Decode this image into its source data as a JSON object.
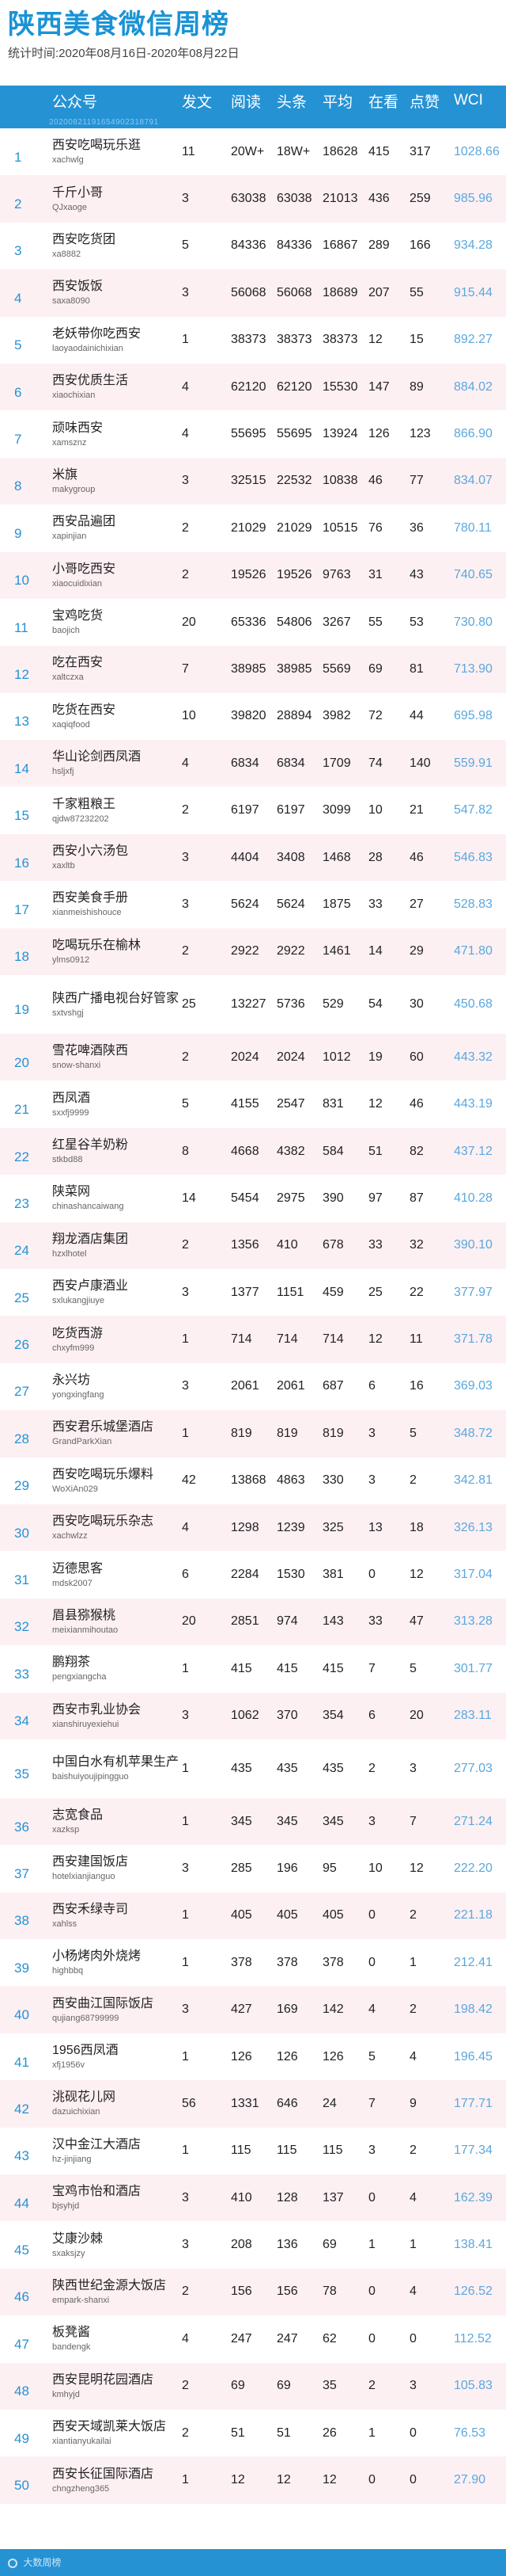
{
  "title": "陕西美食微信周榜",
  "period": "统计时间:2020年08月16日-2020年08月22日",
  "columns": {
    "account": "公众号",
    "posts": "发文",
    "reads": "阅读",
    "headline": "头条",
    "average": "平均",
    "looking": "在看",
    "likes": "点赞",
    "wci": "WCI"
  },
  "header_watermark": "20200821191654902318791",
  "rows": [
    {
      "rank": "1",
      "name": "西安吃喝玩乐逛",
      "id": "xachwlg",
      "posts": "11",
      "reads": "20W+",
      "headline": "18W+",
      "average": "18628",
      "looking": "415",
      "likes": "317",
      "wci": "1028.66"
    },
    {
      "rank": "2",
      "name": "千斤小哥",
      "id": "QJxaoge",
      "posts": "3",
      "reads": "63038",
      "headline": "63038",
      "average": "21013",
      "looking": "436",
      "likes": "259",
      "wci": "985.96"
    },
    {
      "rank": "3",
      "name": "西安吃货团",
      "id": "xa8882",
      "posts": "5",
      "reads": "84336",
      "headline": "84336",
      "average": "16867",
      "looking": "289",
      "likes": "166",
      "wci": "934.28"
    },
    {
      "rank": "4",
      "name": "西安饭饭",
      "id": "saxa8090",
      "posts": "3",
      "reads": "56068",
      "headline": "56068",
      "average": "18689",
      "looking": "207",
      "likes": "55",
      "wci": "915.44"
    },
    {
      "rank": "5",
      "name": "老妖带你吃西安",
      "id": "laoyaodainichixian",
      "posts": "1",
      "reads": "38373",
      "headline": "38373",
      "average": "38373",
      "looking": "12",
      "likes": "15",
      "wci": "892.27"
    },
    {
      "rank": "6",
      "name": "西安优质生活",
      "id": "xiaochixian",
      "posts": "4",
      "reads": "62120",
      "headline": "62120",
      "average": "15530",
      "looking": "147",
      "likes": "89",
      "wci": "884.02"
    },
    {
      "rank": "7",
      "name": "顽味西安",
      "id": "xamsznz",
      "posts": "4",
      "reads": "55695",
      "headline": "55695",
      "average": "13924",
      "looking": "126",
      "likes": "123",
      "wci": "866.90"
    },
    {
      "rank": "8",
      "name": "米旗",
      "id": "makygroup",
      "posts": "3",
      "reads": "32515",
      "headline": "22532",
      "average": "10838",
      "looking": "46",
      "likes": "77",
      "wci": "834.07"
    },
    {
      "rank": "9",
      "name": "西安品遍团",
      "id": "xapinjian",
      "posts": "2",
      "reads": "21029",
      "headline": "21029",
      "average": "10515",
      "looking": "76",
      "likes": "36",
      "wci": "780.11"
    },
    {
      "rank": "10",
      "name": "小哥吃西安",
      "id": "xiaocuidixian",
      "posts": "2",
      "reads": "19526",
      "headline": "19526",
      "average": "9763",
      "looking": "31",
      "likes": "43",
      "wci": "740.65"
    },
    {
      "rank": "11",
      "name": "宝鸡吃货",
      "id": "baojich",
      "posts": "20",
      "reads": "65336",
      "headline": "54806",
      "average": "3267",
      "looking": "55",
      "likes": "53",
      "wci": "730.80"
    },
    {
      "rank": "12",
      "name": "吃在西安",
      "id": "xaltczxa",
      "posts": "7",
      "reads": "38985",
      "headline": "38985",
      "average": "5569",
      "looking": "69",
      "likes": "81",
      "wci": "713.90"
    },
    {
      "rank": "13",
      "name": "吃货在西安",
      "id": "xaqiqfood",
      "posts": "10",
      "reads": "39820",
      "headline": "28894",
      "average": "3982",
      "looking": "72",
      "likes": "44",
      "wci": "695.98"
    },
    {
      "rank": "14",
      "name": "华山论剑西凤酒",
      "id": "hsljxfj",
      "posts": "4",
      "reads": "6834",
      "headline": "6834",
      "average": "1709",
      "looking": "74",
      "likes": "140",
      "wci": "559.91"
    },
    {
      "rank": "15",
      "name": "千家粗粮王",
      "id": "qjdw87232202",
      "posts": "2",
      "reads": "6197",
      "headline": "6197",
      "average": "3099",
      "looking": "10",
      "likes": "21",
      "wci": "547.82"
    },
    {
      "rank": "16",
      "name": "西安小六汤包",
      "id": "xaxltb",
      "posts": "3",
      "reads": "4404",
      "headline": "3408",
      "average": "1468",
      "looking": "28",
      "likes": "46",
      "wci": "546.83"
    },
    {
      "rank": "17",
      "name": "西安美食手册",
      "id": "xianmeishishouce",
      "posts": "3",
      "reads": "5624",
      "headline": "5624",
      "average": "1875",
      "looking": "33",
      "likes": "27",
      "wci": "528.83"
    },
    {
      "rank": "18",
      "name": "吃喝玩乐在榆林",
      "id": "ylms0912",
      "posts": "2",
      "reads": "2922",
      "headline": "2922",
      "average": "1461",
      "looking": "14",
      "likes": "29",
      "wci": "471.80"
    },
    {
      "rank": "19",
      "name": "陕西广播电视台好管家",
      "id": "sxtvshgj",
      "posts": "25",
      "reads": "13227",
      "headline": "5736",
      "average": "529",
      "looking": "54",
      "likes": "30",
      "wci": "450.68",
      "tall": true
    },
    {
      "rank": "20",
      "name": "雪花啤酒陕西",
      "id": "snow-shanxi",
      "posts": "2",
      "reads": "2024",
      "headline": "2024",
      "average": "1012",
      "looking": "19",
      "likes": "60",
      "wci": "443.32"
    },
    {
      "rank": "21",
      "name": "西凤酒",
      "id": "sxxfj9999",
      "posts": "5",
      "reads": "4155",
      "headline": "2547",
      "average": "831",
      "looking": "12",
      "likes": "46",
      "wci": "443.19"
    },
    {
      "rank": "22",
      "name": "红星谷羊奶粉",
      "id": "stkbd88",
      "posts": "8",
      "reads": "4668",
      "headline": "4382",
      "average": "584",
      "looking": "51",
      "likes": "82",
      "wci": "437.12"
    },
    {
      "rank": "23",
      "name": "陕菜网",
      "id": "chinashancaiwang",
      "posts": "14",
      "reads": "5454",
      "headline": "2975",
      "average": "390",
      "looking": "97",
      "likes": "87",
      "wci": "410.28"
    },
    {
      "rank": "24",
      "name": "翔龙酒店集团",
      "id": "hzxlhotel",
      "posts": "2",
      "reads": "1356",
      "headline": "410",
      "average": "678",
      "looking": "33",
      "likes": "32",
      "wci": "390.10"
    },
    {
      "rank": "25",
      "name": "西安卢康酒业",
      "id": "sxlukangjiuye",
      "posts": "3",
      "reads": "1377",
      "headline": "1151",
      "average": "459",
      "looking": "25",
      "likes": "22",
      "wci": "377.97"
    },
    {
      "rank": "26",
      "name": "吃货西游",
      "id": "chxyfm999",
      "posts": "1",
      "reads": "714",
      "headline": "714",
      "average": "714",
      "looking": "12",
      "likes": "11",
      "wci": "371.78"
    },
    {
      "rank": "27",
      "name": "永兴坊",
      "id": "yongxingfang",
      "posts": "3",
      "reads": "2061",
      "headline": "2061",
      "average": "687",
      "looking": "6",
      "likes": "16",
      "wci": "369.03"
    },
    {
      "rank": "28",
      "name": "西安君乐城堡酒店",
      "id": "GrandParkXian",
      "posts": "1",
      "reads": "819",
      "headline": "819",
      "average": "819",
      "looking": "3",
      "likes": "5",
      "wci": "348.72"
    },
    {
      "rank": "29",
      "name": "西安吃喝玩乐爆料",
      "id": "WoXiAn029",
      "posts": "42",
      "reads": "13868",
      "headline": "4863",
      "average": "330",
      "looking": "3",
      "likes": "2",
      "wci": "342.81"
    },
    {
      "rank": "30",
      "name": "西安吃喝玩乐杂志",
      "id": "xachwlzz",
      "posts": "4",
      "reads": "1298",
      "headline": "1239",
      "average": "325",
      "looking": "13",
      "likes": "18",
      "wci": "326.13"
    },
    {
      "rank": "31",
      "name": "迈德思客",
      "id": "mdsk2007",
      "posts": "6",
      "reads": "2284",
      "headline": "1530",
      "average": "381",
      "looking": "0",
      "likes": "12",
      "wci": "317.04"
    },
    {
      "rank": "32",
      "name": "眉县猕猴桃",
      "id": "meixianmihoutao",
      "posts": "20",
      "reads": "2851",
      "headline": "974",
      "average": "143",
      "looking": "33",
      "likes": "47",
      "wci": "313.28"
    },
    {
      "rank": "33",
      "name": "鹏翔茶",
      "id": "pengxiangcha",
      "posts": "1",
      "reads": "415",
      "headline": "415",
      "average": "415",
      "looking": "7",
      "likes": "5",
      "wci": "301.77"
    },
    {
      "rank": "34",
      "name": "西安市乳业协会",
      "id": "xianshiruyexiehui",
      "posts": "3",
      "reads": "1062",
      "headline": "370",
      "average": "354",
      "looking": "6",
      "likes": "20",
      "wci": "283.11"
    },
    {
      "rank": "35",
      "name": "中国白水有机苹果生产",
      "id": "baishuiyoujipingguo",
      "posts": "1",
      "reads": "435",
      "headline": "435",
      "average": "435",
      "looking": "2",
      "likes": "3",
      "wci": "277.03",
      "tall": true
    },
    {
      "rank": "36",
      "name": "志宽食品",
      "id": "xazksp",
      "posts": "1",
      "reads": "345",
      "headline": "345",
      "average": "345",
      "looking": "3",
      "likes": "7",
      "wci": "271.24"
    },
    {
      "rank": "37",
      "name": "西安建国饭店",
      "id": "hotelxianjianguo",
      "posts": "3",
      "reads": "285",
      "headline": "196",
      "average": "95",
      "looking": "10",
      "likes": "12",
      "wci": "222.20"
    },
    {
      "rank": "38",
      "name": "西安禾绿寺司",
      "id": "xahlss",
      "posts": "1",
      "reads": "405",
      "headline": "405",
      "average": "405",
      "looking": "0",
      "likes": "2",
      "wci": "221.18"
    },
    {
      "rank": "39",
      "name": "小杨烤肉外烧烤",
      "id": "highbbq",
      "posts": "1",
      "reads": "378",
      "headline": "378",
      "average": "378",
      "looking": "0",
      "likes": "1",
      "wci": "212.41"
    },
    {
      "rank": "40",
      "name": "西安曲江国际饭店",
      "id": "qujiang68799999",
      "posts": "3",
      "reads": "427",
      "headline": "169",
      "average": "142",
      "looking": "4",
      "likes": "2",
      "wci": "198.42"
    },
    {
      "rank": "41",
      "name": "1956西凤酒",
      "id": "xfj1956v",
      "posts": "1",
      "reads": "126",
      "headline": "126",
      "average": "126",
      "looking": "5",
      "likes": "4",
      "wci": "196.45"
    },
    {
      "rank": "42",
      "name": "洮砚花儿网",
      "id": "dazuichixian",
      "posts": "56",
      "reads": "1331",
      "headline": "646",
      "average": "24",
      "looking": "7",
      "likes": "9",
      "wci": "177.71"
    },
    {
      "rank": "43",
      "name": "汉中金江大酒店",
      "id": "hz-jinjiang",
      "posts": "1",
      "reads": "115",
      "headline": "115",
      "average": "115",
      "looking": "3",
      "likes": "2",
      "wci": "177.34"
    },
    {
      "rank": "44",
      "name": "宝鸡市怡和酒店",
      "id": "bjsyhjd",
      "posts": "3",
      "reads": "410",
      "headline": "128",
      "average": "137",
      "looking": "0",
      "likes": "4",
      "wci": "162.39"
    },
    {
      "rank": "45",
      "name": "艾康沙棘",
      "id": "sxaksjzy",
      "posts": "3",
      "reads": "208",
      "headline": "136",
      "average": "69",
      "looking": "1",
      "likes": "1",
      "wci": "138.41"
    },
    {
      "rank": "46",
      "name": "陕西世纪金源大饭店",
      "id": "empark-shanxi",
      "posts": "2",
      "reads": "156",
      "headline": "156",
      "average": "78",
      "looking": "0",
      "likes": "4",
      "wci": "126.52"
    },
    {
      "rank": "47",
      "name": "板凳酱",
      "id": "bandengk",
      "posts": "4",
      "reads": "247",
      "headline": "247",
      "average": "62",
      "looking": "0",
      "likes": "0",
      "wci": "112.52"
    },
    {
      "rank": "48",
      "name": "西安昆明花园酒店",
      "id": "kmhyjd",
      "posts": "2",
      "reads": "69",
      "headline": "69",
      "average": "35",
      "looking": "2",
      "likes": "3",
      "wci": "105.83"
    },
    {
      "rank": "49",
      "name": "西安天域凯莱大饭店",
      "id": "xiantianyukailai",
      "posts": "2",
      "reads": "51",
      "headline": "51",
      "average": "26",
      "looking": "1",
      "likes": "0",
      "wci": "76.53"
    },
    {
      "rank": "50",
      "name": "西安长征国际酒店",
      "id": "chngzheng365",
      "posts": "1",
      "reads": "12",
      "headline": "12",
      "average": "12",
      "looking": "0",
      "likes": "0",
      "wci": "27.90"
    }
  ],
  "footer": "大数周榜"
}
